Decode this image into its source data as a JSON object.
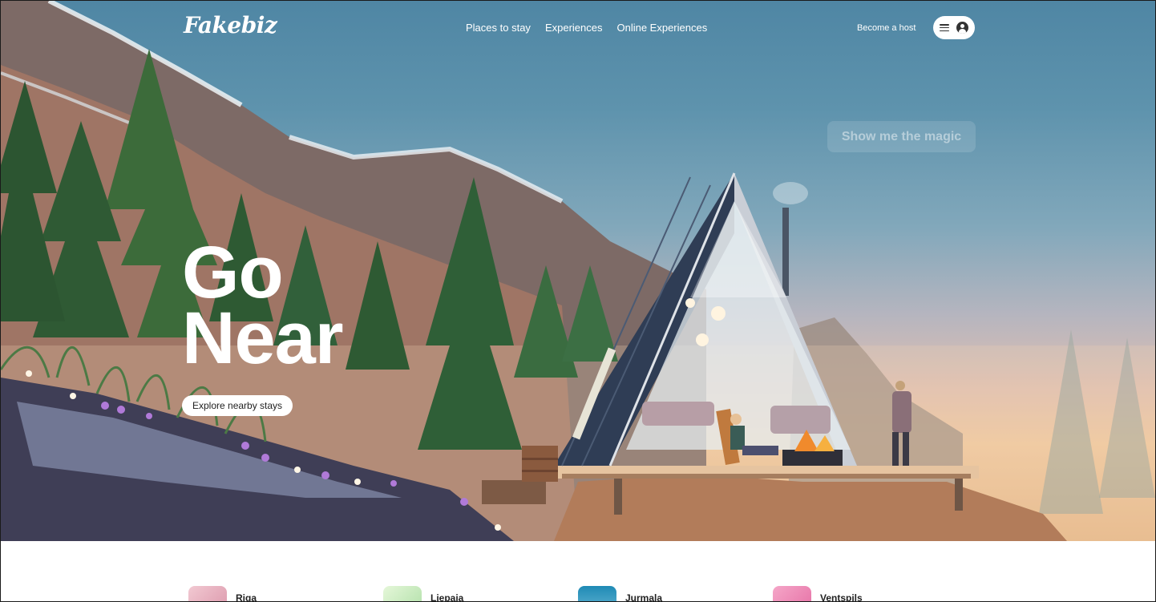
{
  "brand": {
    "logo": "Fakebiz"
  },
  "nav": {
    "links": [
      "Places to stay",
      "Experiences",
      "Online Experiences"
    ],
    "host_link": "Become a host",
    "menu_icon": "hamburger-icon",
    "avatar_icon": "user-avatar-icon"
  },
  "hero": {
    "magic_button": "Show me the magic",
    "headline_line1": "Go",
    "headline_line2": "Near",
    "cta": "Explore nearby stays"
  },
  "cities": [
    {
      "name": "Riga",
      "color": "#e9a9b8"
    },
    {
      "name": "Liepaja",
      "color": "#bfe8b6"
    },
    {
      "name": "Jurmala",
      "color": "#3aa0c8"
    },
    {
      "name": "Ventspils",
      "color": "#e87cb2"
    }
  ]
}
